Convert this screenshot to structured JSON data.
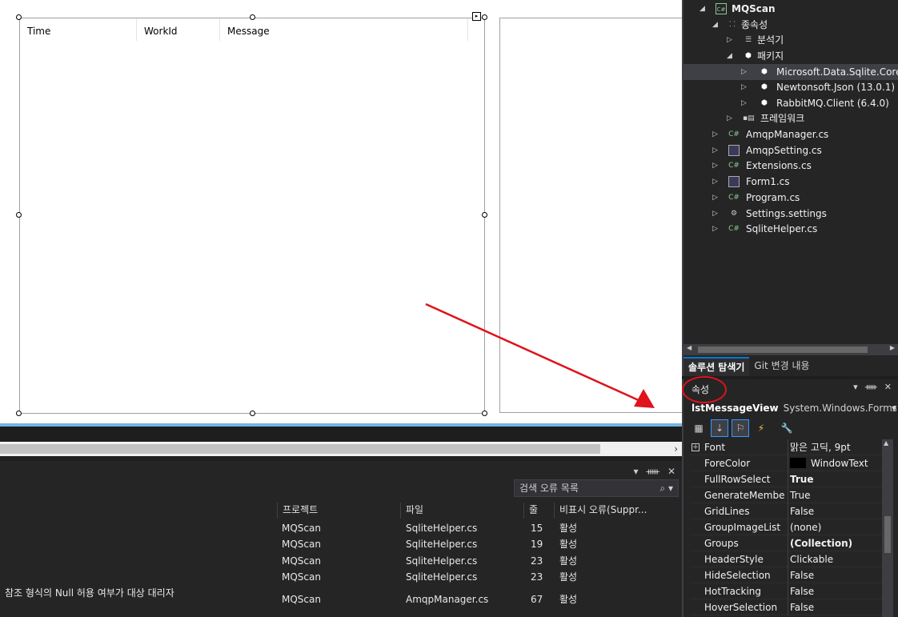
{
  "listview": {
    "columns": [
      "Time",
      "WorkId",
      "Message"
    ]
  },
  "solution_explorer": {
    "items": [
      {
        "label": "MQScan",
        "icon": "csharp-project-icon"
      },
      {
        "label": "종속성",
        "icon": "dependencies-icon"
      },
      {
        "label": "분석기",
        "icon": "analyzer-icon"
      },
      {
        "label": "패키지",
        "icon": "package-icon"
      },
      {
        "label": "Microsoft.Data.Sqlite.Core",
        "icon": "package-icon"
      },
      {
        "label": "Newtonsoft.Json (13.0.1)",
        "icon": "package-icon"
      },
      {
        "label": "RabbitMQ.Client (6.4.0)",
        "icon": "package-icon"
      },
      {
        "label": "프레임워크",
        "icon": "framework-icon"
      },
      {
        "label": "AmqpManager.cs",
        "icon": "csharp-file-icon"
      },
      {
        "label": "AmqpSetting.cs",
        "icon": "form-file-icon"
      },
      {
        "label": "Extensions.cs",
        "icon": "csharp-file-icon"
      },
      {
        "label": "Form1.cs",
        "icon": "form-file-icon"
      },
      {
        "label": "Program.cs",
        "icon": "csharp-file-icon"
      },
      {
        "label": "Settings.settings",
        "icon": "settings-file-icon"
      },
      {
        "label": "SqliteHelper.cs",
        "icon": "csharp-file-icon"
      }
    ],
    "tabs": [
      "솔루션 탐색기",
      "Git 변경 내용"
    ]
  },
  "properties": {
    "title": "속성",
    "object_name": "lstMessageView",
    "object_type": "System.Windows.Forms",
    "rows": [
      {
        "name": "Font",
        "value": "맑은 고딕, 9pt",
        "bold": false,
        "expandable": true
      },
      {
        "name": "ForeColor",
        "value": "WindowText",
        "bold": false,
        "swatch": "#000000"
      },
      {
        "name": "FullRowSelect",
        "value": "True",
        "bold": true
      },
      {
        "name": "GenerateMember",
        "value": "True",
        "bold": false
      },
      {
        "name": "GridLines",
        "value": "False",
        "bold": false
      },
      {
        "name": "GroupImageList",
        "value": "(none)",
        "bold": false
      },
      {
        "name": "Groups",
        "value": "(Collection)",
        "bold": true
      },
      {
        "name": "HeaderStyle",
        "value": "Clickable",
        "bold": false
      },
      {
        "name": "HideSelection",
        "value": "False",
        "bold": false
      },
      {
        "name": "HotTracking",
        "value": "False",
        "bold": false
      },
      {
        "name": "HoverSelection",
        "value": "False",
        "bold": false
      }
    ]
  },
  "error_list": {
    "search_placeholder": "검색 오류 목록",
    "headers": [
      "프로젝트",
      "파일",
      "줄",
      "비표시 오류(Suppr..."
    ],
    "rows": [
      {
        "description": "",
        "project": "MQScan",
        "file": "SqliteHelper.cs",
        "line": "15",
        "state": "활성"
      },
      {
        "description": "",
        "project": "MQScan",
        "file": "SqliteHelper.cs",
        "line": "19",
        "state": "활성"
      },
      {
        "description": "",
        "project": "MQScan",
        "file": "SqliteHelper.cs",
        "line": "23",
        "state": "활성"
      },
      {
        "description": "",
        "project": "MQScan",
        "file": "SqliteHelper.cs",
        "line": "23",
        "state": "활성"
      },
      {
        "description": "참조 형식의 Null 허용 여부가 대상 대리자",
        "project": "MQScan",
        "file": "AmqpManager.cs",
        "line": "67",
        "state": "활성"
      }
    ]
  },
  "colors": {
    "annotation": "#e0121b",
    "accent": "#007acc"
  }
}
